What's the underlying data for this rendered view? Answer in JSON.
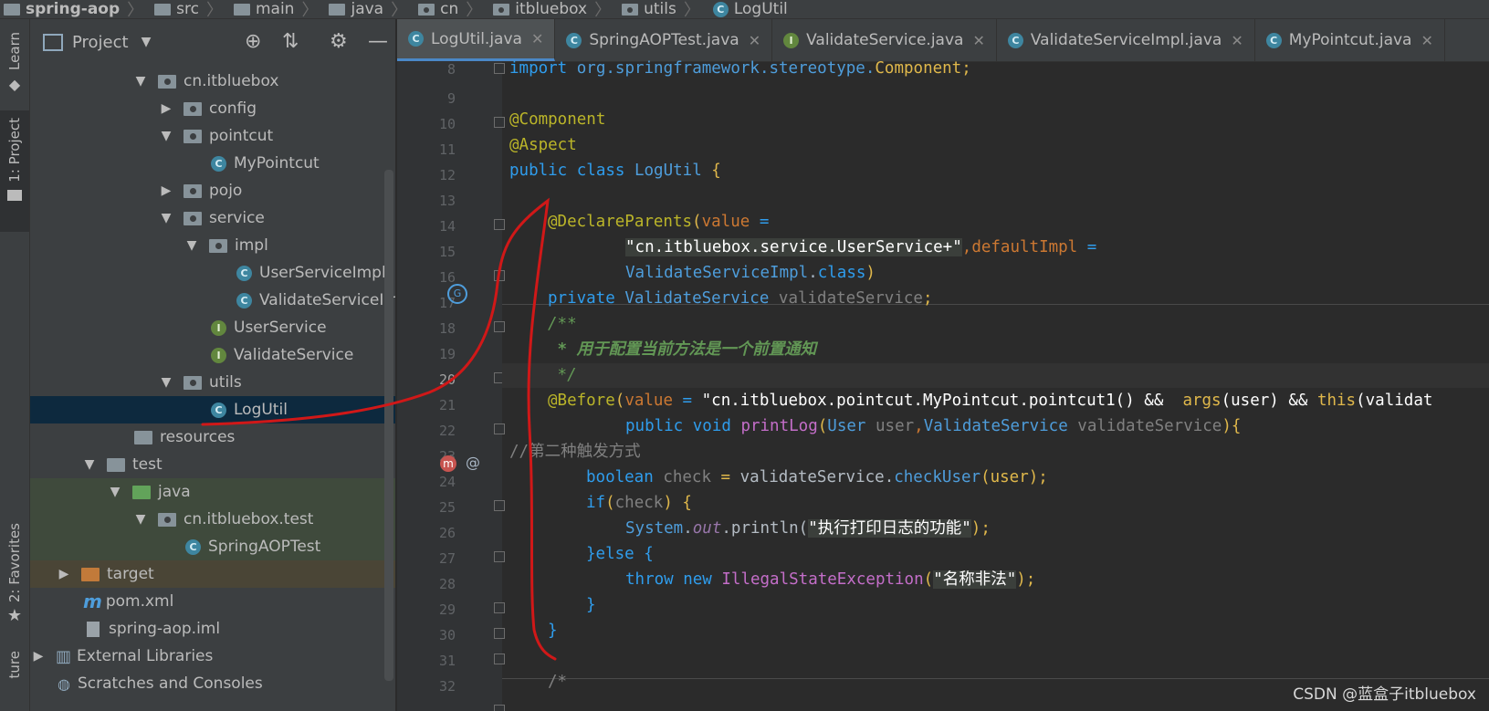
{
  "breadcrumb": [
    "spring-aop",
    "src",
    "main",
    "java",
    "cn",
    "itbluebox",
    "utils",
    "LogUtil"
  ],
  "toolstrip": {
    "learn": "Learn",
    "project": "1: Project",
    "favorites": "2: Favorites",
    "structure": "ture"
  },
  "project_panel": {
    "title": "Project",
    "tree": [
      {
        "label": "cn.itbluebox",
        "arrow": "▼",
        "icon": "package"
      },
      {
        "label": "config",
        "arrow": "▶",
        "icon": "package"
      },
      {
        "label": "pointcut",
        "arrow": "▼",
        "icon": "package"
      },
      {
        "label": "MyPointcut",
        "arrow": "",
        "icon": "class"
      },
      {
        "label": "pojo",
        "arrow": "▶",
        "icon": "package"
      },
      {
        "label": "service",
        "arrow": "▼",
        "icon": "package"
      },
      {
        "label": "impl",
        "arrow": "▼",
        "icon": "package"
      },
      {
        "label": "UserServiceImpl",
        "arrow": "",
        "icon": "class"
      },
      {
        "label": "ValidateServiceImpl",
        "arrow": "",
        "icon": "class"
      },
      {
        "label": "UserService",
        "arrow": "",
        "icon": "interface"
      },
      {
        "label": "ValidateService",
        "arrow": "",
        "icon": "interface"
      },
      {
        "label": "utils",
        "arrow": "▼",
        "icon": "package"
      },
      {
        "label": "LogUtil",
        "arrow": "",
        "icon": "class"
      },
      {
        "label": "resources",
        "arrow": "",
        "icon": "folder"
      },
      {
        "label": "test",
        "arrow": "▼",
        "icon": "folder"
      },
      {
        "label": "java",
        "arrow": "▼",
        "icon": "folder-green"
      },
      {
        "label": "cn.itbluebox.test",
        "arrow": "▼",
        "icon": "package"
      },
      {
        "label": "SpringAOPTest",
        "arrow": "",
        "icon": "test-class"
      },
      {
        "label": "target",
        "arrow": "▶",
        "icon": "folder-orange"
      },
      {
        "label": "pom.xml",
        "arrow": "",
        "icon": "maven"
      },
      {
        "label": "spring-aop.iml",
        "arrow": "",
        "icon": "file"
      },
      {
        "label": "External Libraries",
        "arrow": "▶",
        "icon": "library"
      },
      {
        "label": "Scratches and Consoles",
        "arrow": "",
        "icon": "scratch"
      }
    ]
  },
  "tabs": [
    {
      "label": "LogUtil.java",
      "icon": "class",
      "active": true
    },
    {
      "label": "SpringAOPTest.java",
      "icon": "test-class",
      "active": false
    },
    {
      "label": "ValidateService.java",
      "icon": "interface",
      "active": false
    },
    {
      "label": "ValidateServiceImpl.java",
      "icon": "class",
      "active": false
    },
    {
      "label": "MyPointcut.java",
      "icon": "class",
      "active": false
    }
  ],
  "line_numbers": [
    "8",
    "9",
    "10",
    "11",
    "12",
    "13",
    "14",
    "15",
    "16",
    "17",
    "18",
    "19",
    "20",
    "21",
    "22",
    "23",
    "24",
    "25",
    "26",
    "27",
    "28",
    "29",
    "30",
    "31",
    "32"
  ],
  "code": {
    "l8a": "import",
    "l8b": "org.springframework.stereotype.",
    "l8c": "Component",
    "l8d": ";",
    "l10": "@Component",
    "l11": "@Aspect",
    "l12a": "public class",
    "l12b": "LogUtil",
    "l12c": "{",
    "l14a": "@DeclareParents",
    "l14b": "(",
    "l14c": "value",
    "l14d": "=",
    "l15a": "\"cn.itbluebox.service.UserService+\"",
    "l15b": ",",
    "l15c": "defaultImpl",
    "l15d": "=",
    "l16a": "ValidateServiceImpl",
    "l16b": ".",
    "l16c": "class",
    "l16d": ")",
    "l17a": "private",
    "l17b": "ValidateService",
    "l17c": "validateService",
    "l17d": ";",
    "l18": "/**",
    "l19": " * 用于配置当前方法是一个前置通知",
    "l20": " */",
    "l21a": "@Before",
    "l21b": "(",
    "l21c": "value",
    "l21d": "=",
    "l21e": "\"cn.itbluebox.pointcut.MyPointcut.pointcut1() &&  ",
    "l21f": "args",
    "l21g": "(user) && ",
    "l21h": "this",
    "l21i": "(validat",
    "l22a": "public void",
    "l22b": "printLog",
    "l22c": "(",
    "l22d": "User",
    "l22e": "user",
    "l22f": ",",
    "l22g": "ValidateService",
    "l22h": "validateService",
    "l22i": "){",
    "l23": "//第二种触发方式",
    "l24a": "boolean",
    "l24b": "check",
    "l24c": "=",
    "l24d": "validateService",
    "l24e": ".",
    "l24f": "checkUser",
    "l24g": "(user);",
    "l25a": "if",
    "l25b": "(",
    "l25c": "check",
    "l25d": ") {",
    "l26a": "System",
    "l26b": ".",
    "l26c": "out",
    "l26d": ".println(",
    "l26e": "\"执行打印日志的功能\"",
    "l26f": ");",
    "l27a": "}",
    "l27b": "else",
    "l27c": "{",
    "l28a": "throw new",
    "l28b": "IllegalStateException",
    "l28c": "(",
    "l28d": "\"名称非法\"",
    "l28e": ");",
    "l29": "}",
    "l30": "}",
    "l32": "/*"
  },
  "watermark": "CSDN @蓝盒子itbluebox",
  "colors": {
    "accent": "#4a88c7",
    "selection": "#0d293e",
    "annotation_red": "#d01818"
  }
}
